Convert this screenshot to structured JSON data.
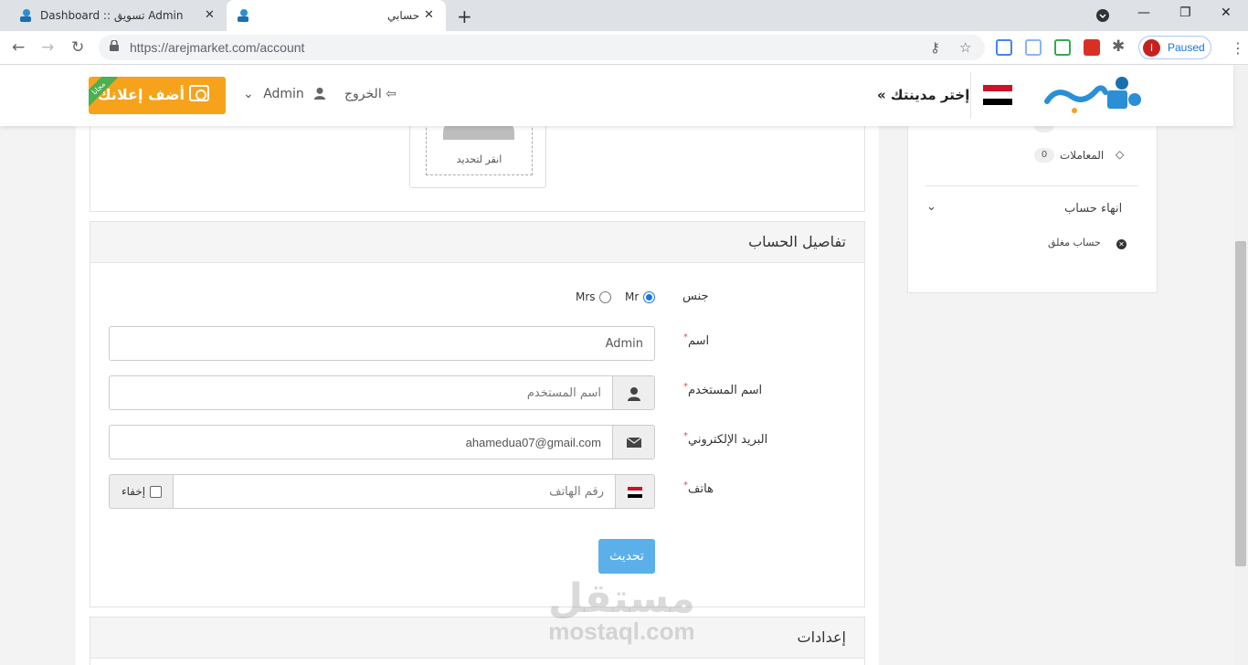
{
  "browser": {
    "tabs": [
      {
        "title": "Dashboard :: تسويق Admin"
      },
      {
        "title": "حسابي"
      }
    ],
    "url": "https://arejmarket.com/account",
    "profile_initial": "I",
    "profile_status": "Paused"
  },
  "header": {
    "ad_button": "أضف إعلانك",
    "ribbon": "مجانا",
    "user_name": "Admin",
    "logout": "الخروج",
    "city": "إختر مدينتك »"
  },
  "avatar": {
    "hint": "انقر لتحديد"
  },
  "account_panel": {
    "title": "تفاصيل الحساب",
    "gender_label": "جنس",
    "gender_options": [
      "Mr",
      "Mrs"
    ],
    "gender_selected": "Mr",
    "name_label": "اسم",
    "name_value": "Admin",
    "username_label": "اسم المستخدم",
    "username_placeholder": "اسم المستخدم",
    "email_label": "البريد الإلكتروني",
    "email_value": "ahamedua07@gmail.com",
    "phone_label": "هاتف",
    "phone_placeholder": "رقم الهاتف",
    "hide_label": "إخفاء",
    "update_button": "تحديث"
  },
  "settings_panel": {
    "title": "إعدادات"
  },
  "sidebar": {
    "transactions_label": "المعاملات",
    "transactions_count": "0",
    "close_account_title": "انهاء حساب",
    "closed_account_label": "حساب مغلق"
  },
  "watermark": {
    "arabic": "مستقل",
    "latin": "mostaql.com"
  },
  "colors": {
    "accent": "#f7a21b",
    "update_button": "#5bb0ea",
    "flag": [
      "#ce1126",
      "#ffffff",
      "#000000"
    ]
  }
}
